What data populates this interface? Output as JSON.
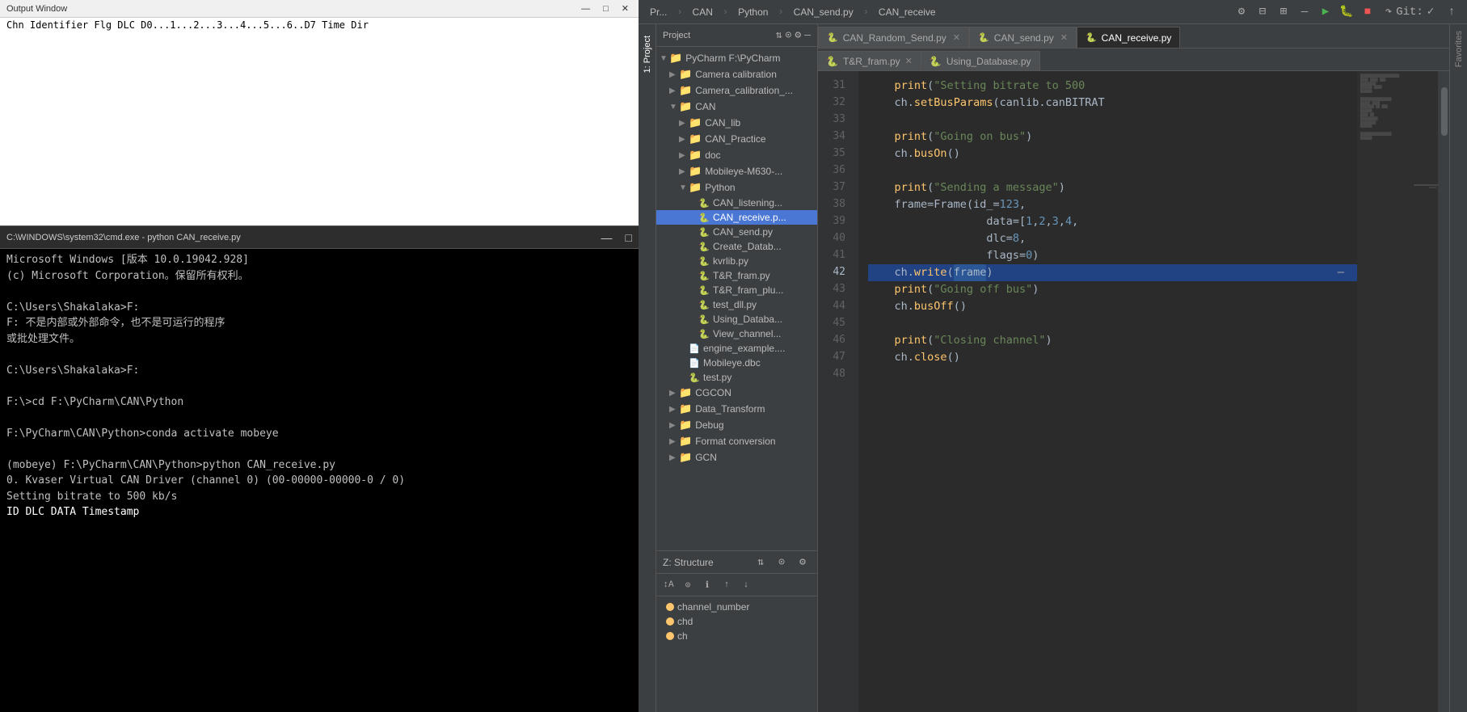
{
  "leftPanel": {
    "topTerminal": {
      "title": "Output Window",
      "tableHeader": "Chn  Identifier  Flg   DLC  D0...1...2...3...4...5...6..D7                           Time    Dir"
    },
    "bottomTerminal": {
      "windowTitle": "C:\\WINDOWS\\system32\\cmd.exe - python  CAN_receive.py",
      "lines": [
        "Microsoft Windows [版本 10.0.19042.928]",
        "(c) Microsoft Corporation。保留所有权利。",
        "",
        "C:\\Users\\Shakalaka>F:",
        "F: 不是内部或外部命令，也不是可运行的程序",
        "或批处理文件。",
        "",
        "C:\\Users\\Shakalaka>F:",
        "",
        "F:\\>cd F:\\PyCharm\\CAN\\Python",
        "",
        "F:\\PyCharm\\CAN\\Python>conda activate mobeye",
        "",
        "(mobeye) F:\\PyCharm\\CAN\\Python>python CAN_receive.py",
        "0. Kvaser Virtual CAN Driver (channel 0) (00-00000-00000-0 / 0)",
        "Setting bitrate to 500 kb/s",
        "    ID      DLC  DATA                         Timestamp"
      ]
    }
  },
  "ide": {
    "topbar": {
      "items": [
        "Pr...",
        "CAN",
        "Python",
        "CAN_send.py",
        "CAN_receive"
      ]
    },
    "toolbar": {
      "icons": [
        "gear",
        "minus",
        "expand"
      ]
    },
    "tabs": {
      "row1": [
        {
          "label": "CAN_Random_Send.py",
          "active": false,
          "hasClose": true
        },
        {
          "label": "CAN_send.py",
          "active": false,
          "hasClose": true
        },
        {
          "label": "CAN_receive.py",
          "active": true,
          "hasClose": false
        }
      ],
      "row2": [
        {
          "label": "T&R_fram.py",
          "active": false,
          "hasClose": true
        },
        {
          "label": "Using_Database.py",
          "active": false,
          "hasClose": false
        }
      ]
    },
    "sidebar": {
      "title": "1: Project",
      "tree": [
        {
          "indent": 0,
          "type": "root",
          "label": "PyCharm F:\\PyCharm",
          "expanded": true
        },
        {
          "indent": 1,
          "type": "folder",
          "label": "Camera calibration",
          "expanded": false
        },
        {
          "indent": 1,
          "type": "folder",
          "label": "Camera_calibration_...",
          "expanded": false
        },
        {
          "indent": 1,
          "type": "folder",
          "label": "CAN",
          "expanded": true,
          "selected": false
        },
        {
          "indent": 2,
          "type": "folder",
          "label": "CAN_lib",
          "expanded": false
        },
        {
          "indent": 2,
          "type": "folder",
          "label": "CAN_Practice",
          "expanded": false
        },
        {
          "indent": 2,
          "type": "folder",
          "label": "doc",
          "expanded": false
        },
        {
          "indent": 2,
          "type": "folder",
          "label": "Mobileye-M630-...",
          "expanded": false
        },
        {
          "indent": 2,
          "type": "folder",
          "label": "Python",
          "expanded": true
        },
        {
          "indent": 3,
          "type": "file",
          "label": "CAN_listening...",
          "ext": "py"
        },
        {
          "indent": 3,
          "type": "file",
          "label": "CAN_receive.p...",
          "ext": "py",
          "selected": true
        },
        {
          "indent": 3,
          "type": "file",
          "label": "CAN_send.py",
          "ext": "py"
        },
        {
          "indent": 3,
          "type": "file",
          "label": "Create_Datab...",
          "ext": "py"
        },
        {
          "indent": 3,
          "type": "file",
          "label": "kvrlib.py",
          "ext": "py"
        },
        {
          "indent": 3,
          "type": "file",
          "label": "T&R_fram.py",
          "ext": "py"
        },
        {
          "indent": 3,
          "type": "file",
          "label": "T&R_fram_plu...",
          "ext": "py"
        },
        {
          "indent": 3,
          "type": "file",
          "label": "test_dll.py",
          "ext": "py"
        },
        {
          "indent": 3,
          "type": "file",
          "label": "Using_Databa...",
          "ext": "py"
        },
        {
          "indent": 3,
          "type": "file",
          "label": "View_channel...",
          "ext": "py"
        },
        {
          "indent": 2,
          "type": "file",
          "label": "engine_example....",
          "ext": "misc"
        },
        {
          "indent": 2,
          "type": "file",
          "label": "Mobileye.dbc",
          "ext": "dbc"
        },
        {
          "indent": 2,
          "type": "file",
          "label": "test.py",
          "ext": "py"
        },
        {
          "indent": 1,
          "type": "folder",
          "label": "CGCON",
          "expanded": false
        },
        {
          "indent": 1,
          "type": "folder",
          "label": "Data_Transform",
          "expanded": false
        },
        {
          "indent": 1,
          "type": "folder",
          "label": "Debug",
          "expanded": false
        },
        {
          "indent": 1,
          "type": "folder",
          "label": "Format conversion",
          "expanded": false
        },
        {
          "indent": 1,
          "type": "folder",
          "label": "GCN",
          "expanded": false
        }
      ]
    },
    "editor": {
      "lines": [
        {
          "num": 31,
          "content": "    print(\"Setting bitrate to 500",
          "type": "code"
        },
        {
          "num": 32,
          "content": "    ch.setBusParams(canlib.canBITRAT",
          "type": "code"
        },
        {
          "num": 33,
          "content": "",
          "type": "empty"
        },
        {
          "num": 34,
          "content": "    print(\"Going on bus\")",
          "type": "code"
        },
        {
          "num": 35,
          "content": "    ch.busOn()",
          "type": "code"
        },
        {
          "num": 36,
          "content": "",
          "type": "empty"
        },
        {
          "num": 37,
          "content": "    print(\"Sending a message\")",
          "type": "code"
        },
        {
          "num": 38,
          "content": "    frame = Frame(id_=123,",
          "type": "code"
        },
        {
          "num": 39,
          "content": "                  data=[1, 2, 3, 4,",
          "type": "code"
        },
        {
          "num": 40,
          "content": "                  dlc=8,",
          "type": "code"
        },
        {
          "num": 41,
          "content": "                  flags=0)",
          "type": "code"
        },
        {
          "num": 42,
          "content": "    ch.write(frame)",
          "type": "highlighted"
        },
        {
          "num": 43,
          "content": "    print(\"Going off bus\")",
          "type": "code"
        },
        {
          "num": 44,
          "content": "    ch.busOff()",
          "type": "code"
        },
        {
          "num": 45,
          "content": "",
          "type": "empty"
        },
        {
          "num": 46,
          "content": "    print(\"Closing channel\")",
          "type": "code"
        },
        {
          "num": 47,
          "content": "    ch.close()",
          "type": "code"
        },
        {
          "num": 48,
          "content": "",
          "type": "empty"
        }
      ]
    },
    "structure": {
      "title": "Z: Structure",
      "items": [
        {
          "label": "channel_number",
          "color": "yellow"
        },
        {
          "label": "chd",
          "color": "yellow"
        },
        {
          "label": "ch",
          "color": "yellow"
        }
      ]
    }
  }
}
